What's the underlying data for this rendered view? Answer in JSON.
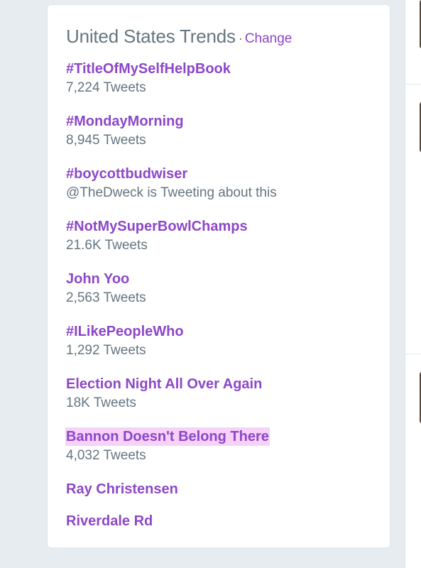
{
  "trends_module": {
    "title": "United States Trends",
    "separator": "·",
    "change_label": "Change",
    "colors": {
      "link": "#8c47c9",
      "meta": "#66757f",
      "highlight": "#f6d2f9"
    },
    "trends": [
      {
        "name": "#TitleOfMySelfHelpBook",
        "meta": "7,224 Tweets"
      },
      {
        "name": "#MondayMorning",
        "meta": "8,945 Tweets"
      },
      {
        "name": "#boycottbudwiser",
        "meta": "@TheDweck is Tweeting about this"
      },
      {
        "name": "#NotMySuperBowlChamps",
        "meta": "21.6K Tweets"
      },
      {
        "name": "John Yoo",
        "meta": "2,563 Tweets"
      },
      {
        "name": "#ILikePeopleWho",
        "meta": "1,292 Tweets"
      },
      {
        "name": "Election Night All Over Again",
        "meta": "18K Tweets"
      },
      {
        "name": "Bannon Doesn't Belong There",
        "meta": "4,032 Tweets",
        "highlighted": true
      },
      {
        "name": "Ray Christensen"
      },
      {
        "name": "Riverdale Rd"
      }
    ]
  }
}
